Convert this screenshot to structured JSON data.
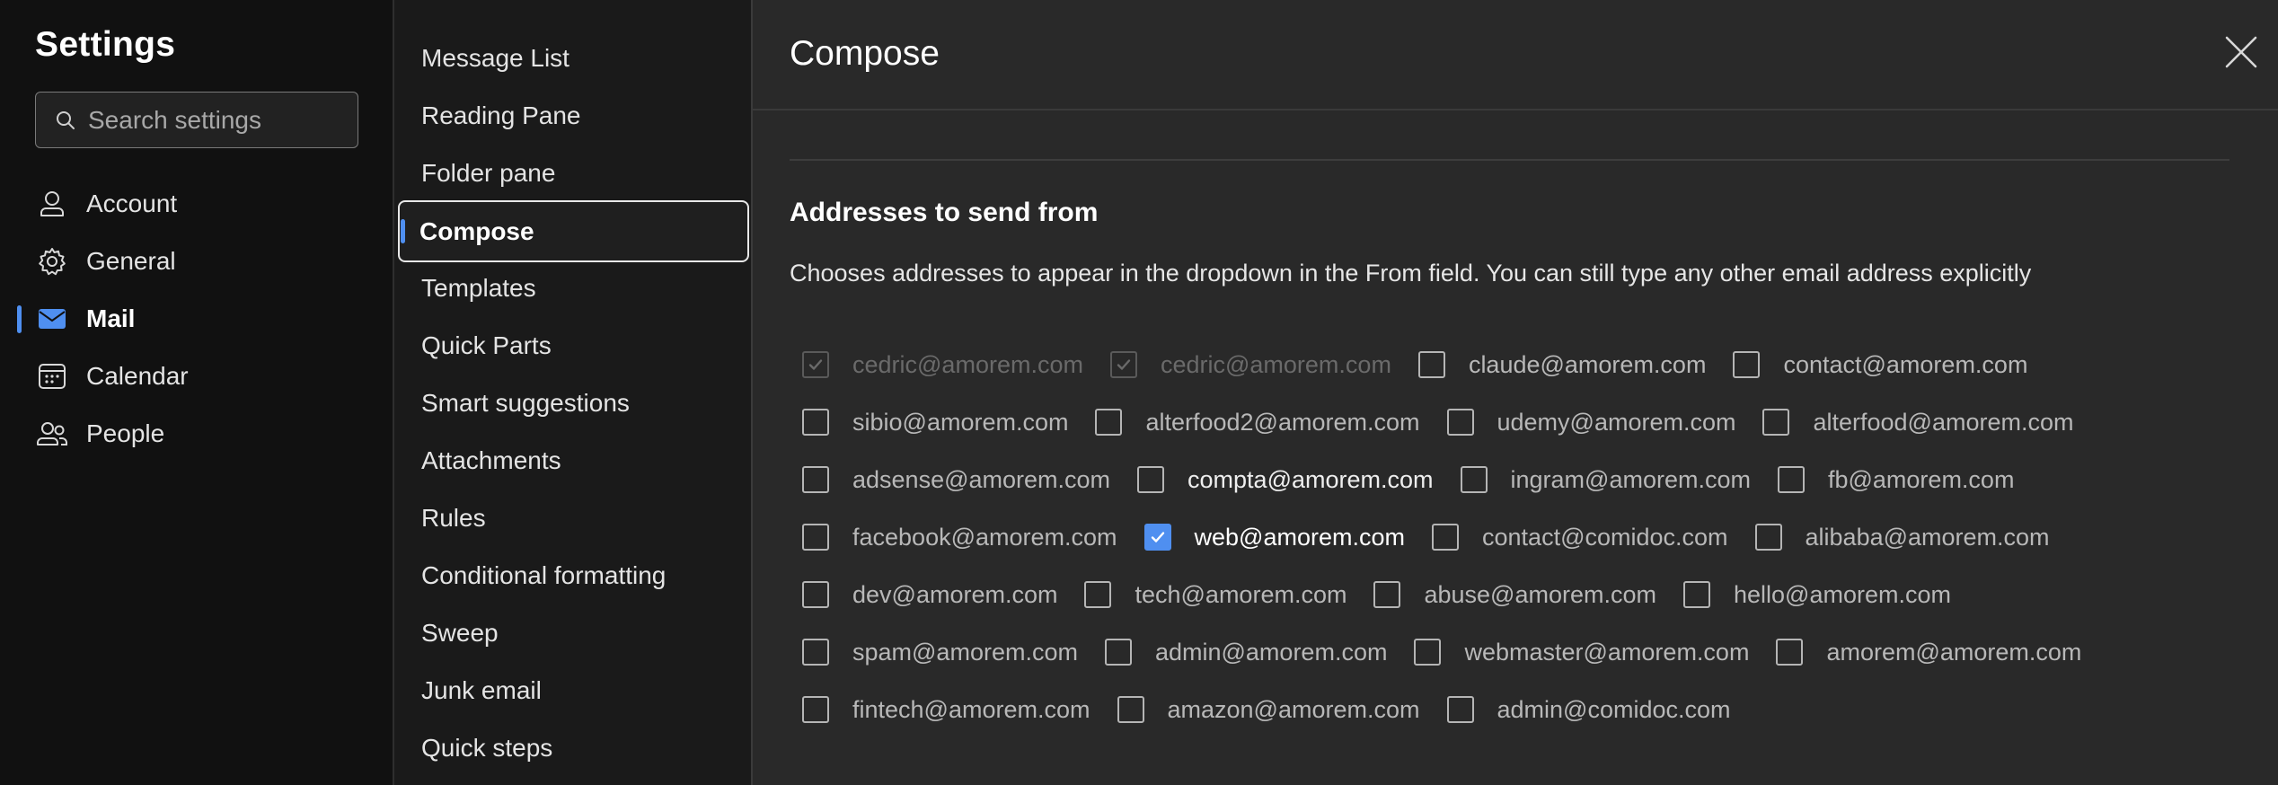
{
  "left": {
    "title": "Settings",
    "search_placeholder": "Search settings",
    "items": [
      {
        "label": "Account",
        "icon": "person-icon"
      },
      {
        "label": "General",
        "icon": "gear-icon"
      },
      {
        "label": "Mail",
        "icon": "mail-icon",
        "active": true
      },
      {
        "label": "Calendar",
        "icon": "calendar-icon"
      },
      {
        "label": "People",
        "icon": "people-icon"
      }
    ]
  },
  "middle": {
    "items": [
      {
        "label": "Message List"
      },
      {
        "label": "Reading Pane"
      },
      {
        "label": "Folder pane"
      },
      {
        "label": "Compose",
        "active": true
      },
      {
        "label": "Templates"
      },
      {
        "label": "Quick Parts"
      },
      {
        "label": "Smart suggestions"
      },
      {
        "label": "Attachments"
      },
      {
        "label": "Rules"
      },
      {
        "label": "Conditional formatting"
      },
      {
        "label": "Sweep"
      },
      {
        "label": "Junk email"
      },
      {
        "label": "Quick steps"
      }
    ]
  },
  "panel": {
    "title": "Compose",
    "section_heading": "Addresses to send from",
    "section_desc": "Chooses addresses to appear in the dropdown in the From field. You can still type any other email address explicitly",
    "rows": [
      [
        {
          "email": "cedric@amorem.com",
          "checked": true,
          "disabled": true
        },
        {
          "email": "cedric@amorem.com",
          "checked": true,
          "disabled": true
        },
        {
          "email": "claude@amorem.com",
          "checked": false
        },
        {
          "email": "contact@amorem.com",
          "checked": false
        }
      ],
      [
        {
          "email": "sibio@amorem.com",
          "checked": false
        },
        {
          "email": "alterfood2@amorem.com",
          "checked": false
        },
        {
          "email": "udemy@amorem.com",
          "checked": false
        },
        {
          "email": "alterfood@amorem.com",
          "checked": false
        }
      ],
      [
        {
          "email": "adsense@amorem.com",
          "checked": false
        },
        {
          "email": "compta@amorem.com",
          "checked": false,
          "bright": true
        },
        {
          "email": "ingram@amorem.com",
          "checked": false
        },
        {
          "email": "fb@amorem.com",
          "checked": false
        }
      ],
      [
        {
          "email": "facebook@amorem.com",
          "checked": false
        },
        {
          "email": "web@amorem.com",
          "checked": true
        },
        {
          "email": "contact@comidoc.com",
          "checked": false
        },
        {
          "email": "alibaba@amorem.com",
          "checked": false
        }
      ],
      [
        {
          "email": "dev@amorem.com",
          "checked": false
        },
        {
          "email": "tech@amorem.com",
          "checked": false
        },
        {
          "email": "abuse@amorem.com",
          "checked": false
        },
        {
          "email": "hello@amorem.com",
          "checked": false
        }
      ],
      [
        {
          "email": "spam@amorem.com",
          "checked": false
        },
        {
          "email": "admin@amorem.com",
          "checked": false
        },
        {
          "email": "webmaster@amorem.com",
          "checked": false
        },
        {
          "email": "amorem@amorem.com",
          "checked": false
        }
      ],
      [
        {
          "email": "fintech@amorem.com",
          "checked": false
        },
        {
          "email": "amazon@amorem.com",
          "checked": false
        },
        {
          "email": "admin@comidoc.com",
          "checked": false
        }
      ]
    ]
  },
  "colors": {
    "accent": "#4f8ff0",
    "background": "#111111",
    "panel": "#292929"
  }
}
